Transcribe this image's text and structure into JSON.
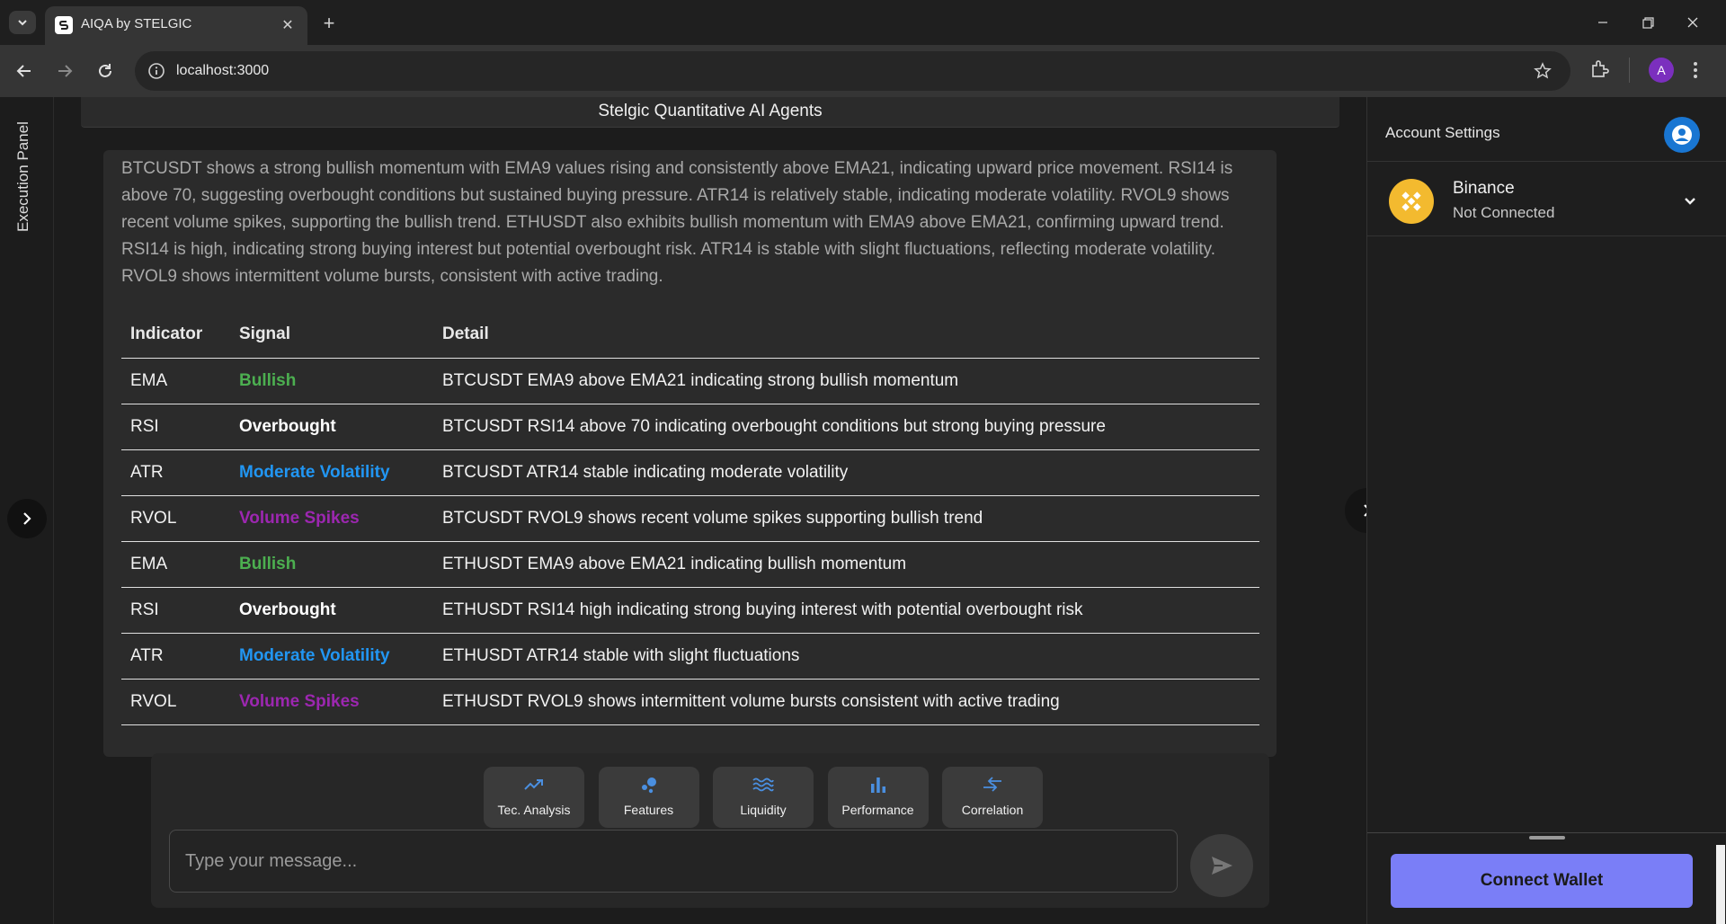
{
  "browser": {
    "tab_title": "AIQA by STELGIC",
    "tab_close": "✕",
    "new_tab": "+",
    "url": "localhost:3000",
    "profile_initial": "A"
  },
  "app": {
    "execution_panel_label": "Execution Panel",
    "header_title": "Stelgic Quantitative AI Agents",
    "message_text": "BTCUSDT shows a strong bullish momentum with EMA9 values rising and consistently above EMA21, indicating upward price movement. RSI14 is above 70, suggesting overbought conditions but sustained buying pressure. ATR14 is relatively stable, indicating moderate volatility. RVOL9 shows recent volume spikes, supporting the bullish trend. ETHUSDT also exhibits bullish momentum with EMA9 above EMA21, confirming upward trend. RSI14 is high, indicating strong buying interest but potential overbought risk. ATR14 is stable with slight fluctuations, reflecting moderate volatility. RVOL9 shows intermittent volume bursts, consistent with active trading.",
    "table": {
      "headers": [
        "Indicator",
        "Signal",
        "Detail"
      ],
      "rows": [
        {
          "indicator": "EMA",
          "signal": "Bullish",
          "signal_color": "#4caf50",
          "detail": "BTCUSDT EMA9 above EMA21 indicating strong bullish momentum"
        },
        {
          "indicator": "RSI",
          "signal": "Overbought",
          "signal_color": "#ffffff",
          "detail": "BTCUSDT RSI14 above 70 indicating overbought conditions but strong buying pressure"
        },
        {
          "indicator": "ATR",
          "signal": "Moderate Volatility",
          "signal_color": "#2196f3",
          "detail": "BTCUSDT ATR14 stable indicating moderate volatility"
        },
        {
          "indicator": "RVOL",
          "signal": "Volume Spikes",
          "signal_color": "#9c27b0",
          "detail": "BTCUSDT RVOL9 shows recent volume spikes supporting bullish trend"
        },
        {
          "indicator": "EMA",
          "signal": "Bullish",
          "signal_color": "#4caf50",
          "detail": "ETHUSDT EMA9 above EMA21 indicating bullish momentum"
        },
        {
          "indicator": "RSI",
          "signal": "Overbought",
          "signal_color": "#ffffff",
          "detail": "ETHUSDT RSI14 high indicating strong buying interest with potential overbought risk"
        },
        {
          "indicator": "ATR",
          "signal": "Moderate Volatility",
          "signal_color": "#2196f3",
          "detail": "ETHUSDT ATR14 stable with slight fluctuations"
        },
        {
          "indicator": "RVOL",
          "signal": "Volume Spikes",
          "signal_color": "#9c27b0",
          "detail": "ETHUSDT RVOL9 shows intermittent volume bursts consistent with active trading"
        }
      ]
    },
    "quick_actions": [
      {
        "label": "Tec. Analysis",
        "icon": "trending-up-icon"
      },
      {
        "label": "Features",
        "icon": "bubbles-icon"
      },
      {
        "label": "Liquidity",
        "icon": "waves-icon"
      },
      {
        "label": "Performance",
        "icon": "bar-chart-icon"
      },
      {
        "label": "Correlation",
        "icon": "compare-arrows-icon"
      }
    ],
    "input_placeholder": "Type your message...",
    "accent_icon_color": "#4a8fe0"
  },
  "right_panel": {
    "title": "Account Settings",
    "exchange": {
      "name": "Binance",
      "status": "Not Connected"
    },
    "connect_wallet_label": "Connect Wallet"
  }
}
